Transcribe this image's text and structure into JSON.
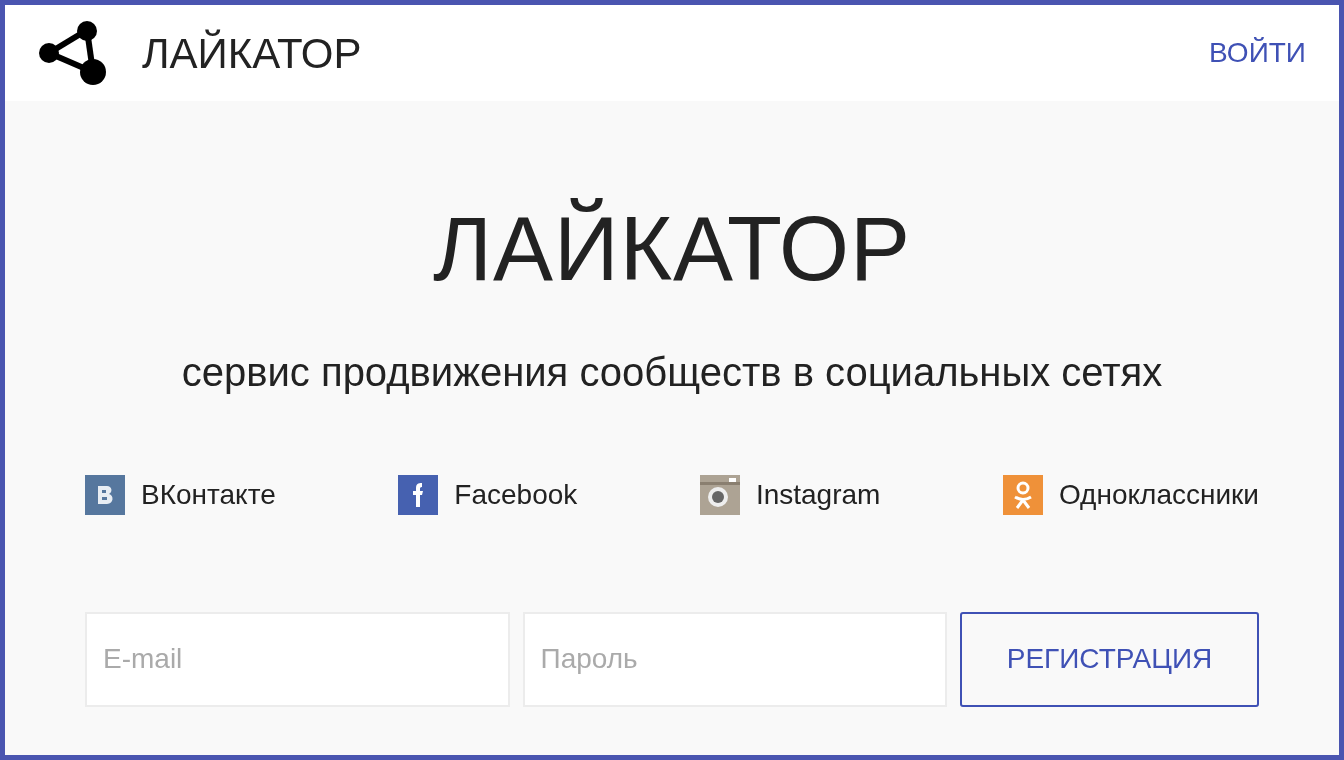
{
  "header": {
    "brand": "ЛАЙКАТОР",
    "login": "ВОЙТИ"
  },
  "hero": {
    "title": "ЛАЙКАТОР",
    "subtitle": "сервис продвижения сообществ в социальных сетях"
  },
  "networks": [
    {
      "kind": "vk",
      "label": "ВКонтакте"
    },
    {
      "kind": "facebook",
      "label": "Facebook"
    },
    {
      "kind": "instagram",
      "label": "Instagram"
    },
    {
      "kind": "ok",
      "label": "Одноклассники"
    }
  ],
  "form": {
    "email": {
      "placeholder": "E-mail"
    },
    "password": {
      "placeholder": "Пароль"
    },
    "submit": "РЕГИСТРАЦИЯ"
  }
}
